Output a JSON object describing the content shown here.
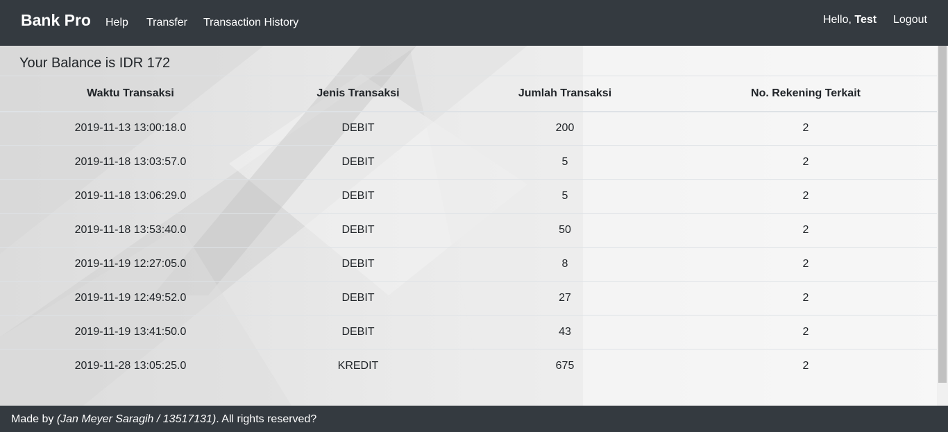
{
  "navbar": {
    "brand": "Bank Pro",
    "links": [
      "Help",
      "Transfer",
      "Transaction History"
    ],
    "greeting": "Hello,",
    "username": "Test",
    "logout": "Logout"
  },
  "balance_text": "Your Balance is IDR 172",
  "table": {
    "headers": [
      "Waktu Transaksi",
      "Jenis Transaksi",
      "Jumlah Transaksi",
      "No. Rekening Terkait"
    ],
    "rows": [
      [
        "2019-11-13 13:00:18.0",
        "DEBIT",
        "200",
        "2"
      ],
      [
        "2019-11-18 13:03:57.0",
        "DEBIT",
        "5",
        "2"
      ],
      [
        "2019-11-18 13:06:29.0",
        "DEBIT",
        "5",
        "2"
      ],
      [
        "2019-11-18 13:53:40.0",
        "DEBIT",
        "50",
        "2"
      ],
      [
        "2019-11-19 12:27:05.0",
        "DEBIT",
        "8",
        "2"
      ],
      [
        "2019-11-19 12:49:52.0",
        "DEBIT",
        "27",
        "2"
      ],
      [
        "2019-11-19 13:41:50.0",
        "DEBIT",
        "43",
        "2"
      ],
      [
        "2019-11-28 13:05:25.0",
        "KREDIT",
        "675",
        "2"
      ]
    ]
  },
  "footer": {
    "prefix": "Made by ",
    "author": "(Jan Meyer Saragih / 13517131)",
    "suffix": ". All rights reserved?"
  },
  "colors": {
    "navbar": "#343a40",
    "text": "#212529"
  }
}
